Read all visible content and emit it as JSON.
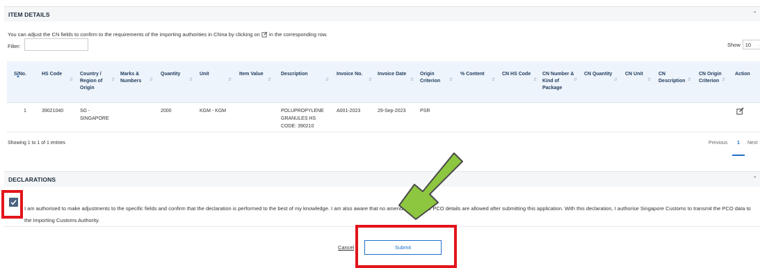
{
  "item_details": {
    "title": "ITEM DETAILS",
    "intro_before": "You can adjust the CN fields to confirm to the requirements of the importing authorities in China by clicking on",
    "intro_after": "in the corresponding row.",
    "filter_label": "Filter:",
    "filter_value": "",
    "show_label": "Show",
    "show_value": "10",
    "entries_label": "entrie"
  },
  "table": {
    "columns": [
      "S/No.",
      "HS Code",
      "Country / Region of Origin",
      "Marks & Numbers",
      "Quantity",
      "Unit",
      "Item Value",
      "Description",
      "Invoice No.",
      "Invoice Date",
      "Origin Criterion",
      "% Content",
      "CN HS Code",
      "CN Number & Kind of Package",
      "CN Quantity",
      "CN Unit",
      "CN Description",
      "CN Origin Criterion",
      "Action"
    ],
    "rows": [
      {
        "sno": "1",
        "hs_code": "39021040",
        "country": "SG - SINGAPORE",
        "marks": "",
        "quantity": "2000",
        "unit": "KGM - KGM",
        "item_value": "",
        "description": "POLUPROPYLENE GRANULES HS CODE: 390210",
        "invoice_no": "A001-2023",
        "invoice_date": "29-Sep-2023",
        "origin_criterion": "PSR",
        "action_icon": "edit-icon"
      }
    ],
    "showing": "Showing 1 to 1 of 1 entries",
    "pagination": {
      "previous": "Previous",
      "current": "1",
      "next": "Next"
    }
  },
  "declarations": {
    "title": "DECLARATIONS",
    "checked": true,
    "text": "I am authorised to make adjustments to the specific fields and confirm that the declaration is performed to the best of my knowledge. I am also aware that no amendments to the PCO details are allowed after submitting this application. With this declaration, I authorise Singapore Customs to transmit the PCO data to the Importing Customs Authority."
  },
  "actions": {
    "cancel": "Cancel",
    "submit": "Submit"
  },
  "colors": {
    "accent": "#1f6fc9",
    "highlight": "#e3141b",
    "arrow": "#8dc63f"
  }
}
